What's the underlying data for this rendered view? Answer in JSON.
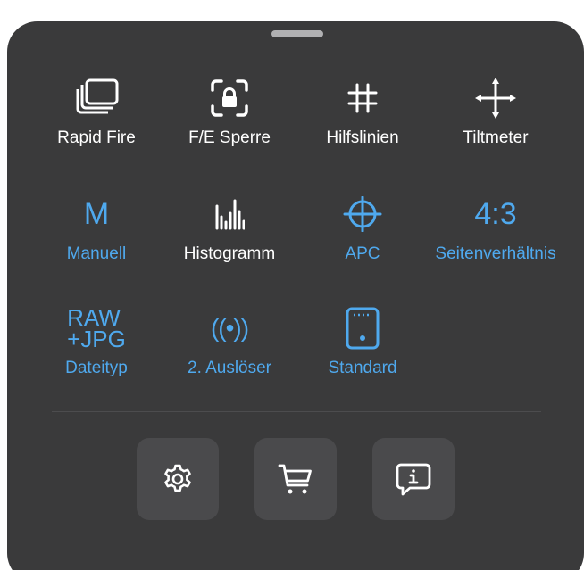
{
  "panel": {
    "row1": [
      {
        "label": "Rapid Fire",
        "icon": "stacked-photos-icon"
      },
      {
        "label": "F/E Sperre",
        "icon": "focus-lock-icon"
      },
      {
        "label": "Hilfslinien",
        "icon": "grid-icon"
      },
      {
        "label": "Tiltmeter",
        "icon": "crosshair-arrows-icon"
      }
    ],
    "row2": [
      {
        "label": "Manuell",
        "icon_text": "M"
      },
      {
        "label": "Histogramm",
        "icon": "histogram-icon"
      },
      {
        "label": "APC",
        "icon": "apc-target-icon"
      },
      {
        "label": "Seitenverhältnis",
        "icon_text": "4:3"
      }
    ],
    "row3": [
      {
        "label": "Dateityp",
        "icon_text_line1": "RAW",
        "icon_text_line2": "+JPG"
      },
      {
        "label": "2. Auslöser",
        "icon_text": "((•))"
      },
      {
        "label": "Standard",
        "icon": "phone-frame-icon"
      }
    ],
    "bottom_buttons": [
      {
        "icon": "gear-icon"
      },
      {
        "icon": "cart-icon"
      },
      {
        "icon": "info-bubble-icon"
      }
    ],
    "colors": {
      "panel_bg": "#3a3a3b",
      "button_bg": "#4a4a4c",
      "accent_blue": "#4fa9ee",
      "text_white": "#ffffff"
    }
  }
}
